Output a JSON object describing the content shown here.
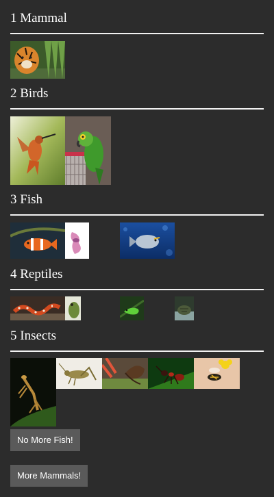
{
  "groups": [
    {
      "title": "1 Mammal",
      "items": [
        "tiger"
      ]
    },
    {
      "title": "2 Birds",
      "items": [
        "hummingbird",
        "parrot"
      ]
    },
    {
      "title": "3 Fish",
      "items": [
        "clownfish",
        "betta-fish",
        "blue-reef-fish"
      ]
    },
    {
      "title": "4 Reptiles",
      "items": [
        "snake",
        "chameleon",
        "green-lizard",
        "turtle"
      ]
    },
    {
      "title": "5 Insects",
      "items": [
        "praying-mantis",
        "grasshopper",
        "butterfly",
        "ant",
        "hoverfly"
      ]
    }
  ],
  "buttons": {
    "no_more_fish": "No More Fish!",
    "more_mammals": "More Mammals!"
  }
}
